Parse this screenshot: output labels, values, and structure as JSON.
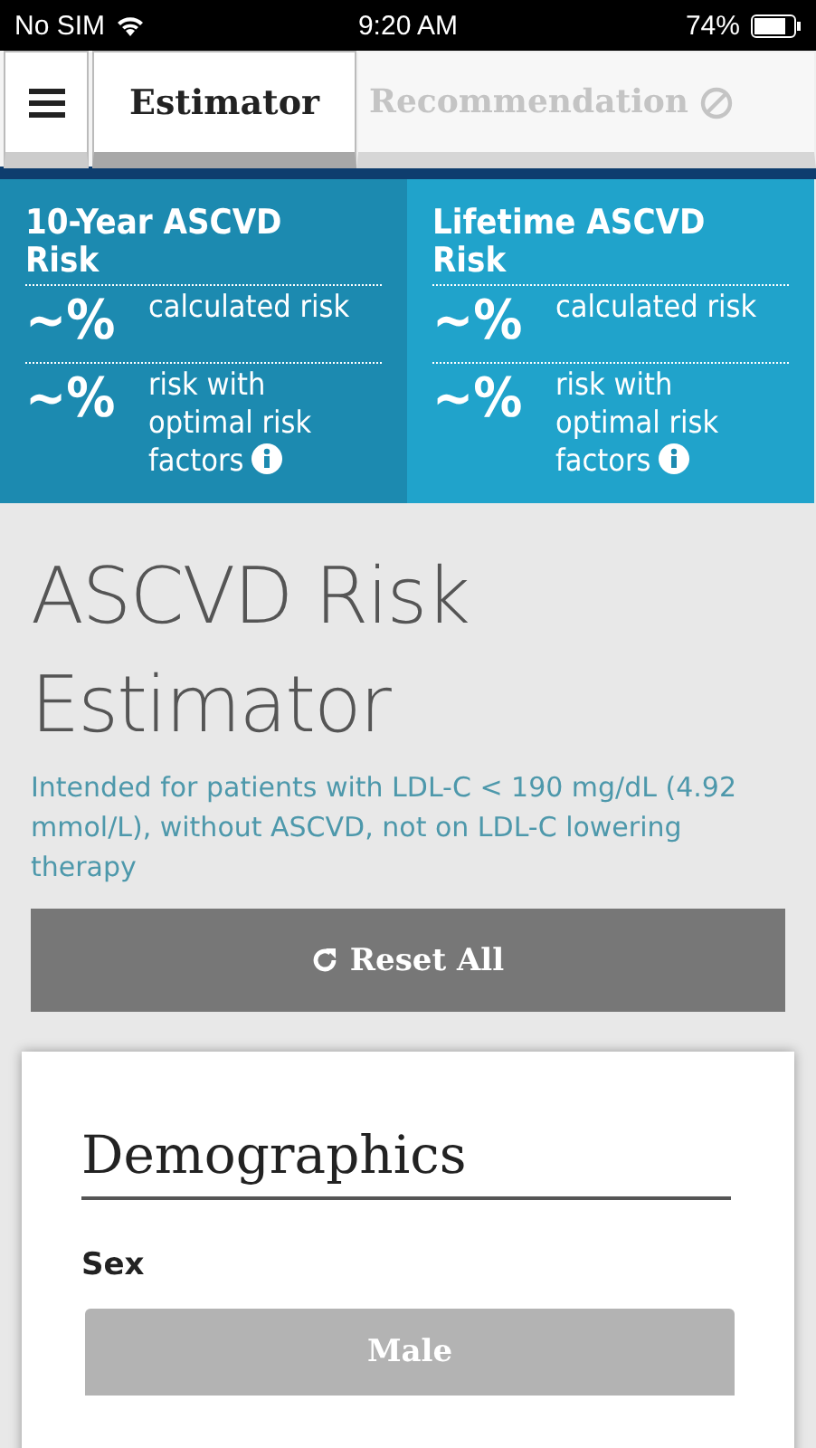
{
  "status_bar": {
    "carrier": "No SIM",
    "time": "9:20 AM",
    "battery": "74%"
  },
  "tabs": [
    {
      "label": "Estimator",
      "selected": true,
      "disabled": false
    },
    {
      "label": "Recommendation",
      "selected": false,
      "disabled": true
    }
  ],
  "risk_panels": [
    {
      "title": "10-Year ASCVD Risk",
      "rows": [
        {
          "value": "~%",
          "label": "calculated risk",
          "info": false
        },
        {
          "value": "~%",
          "label": "risk with optimal risk factors",
          "info": true
        }
      ]
    },
    {
      "title": "Lifetime ASCVD Risk",
      "rows": [
        {
          "value": "~%",
          "label": "calculated risk",
          "info": false
        },
        {
          "value": "~%",
          "label": "risk with optimal risk factors",
          "info": true
        }
      ]
    }
  ],
  "page_title": "ASCVD Risk Estimator",
  "subtitle": "Intended for patients with LDL-C < 190 mg/dL (4.92 mmol/L), without ASCVD, not on LDL-C lowering therapy",
  "reset_button": "Reset All",
  "section": {
    "title": "Demographics",
    "field_label": "Sex",
    "options": [
      "Male"
    ]
  }
}
